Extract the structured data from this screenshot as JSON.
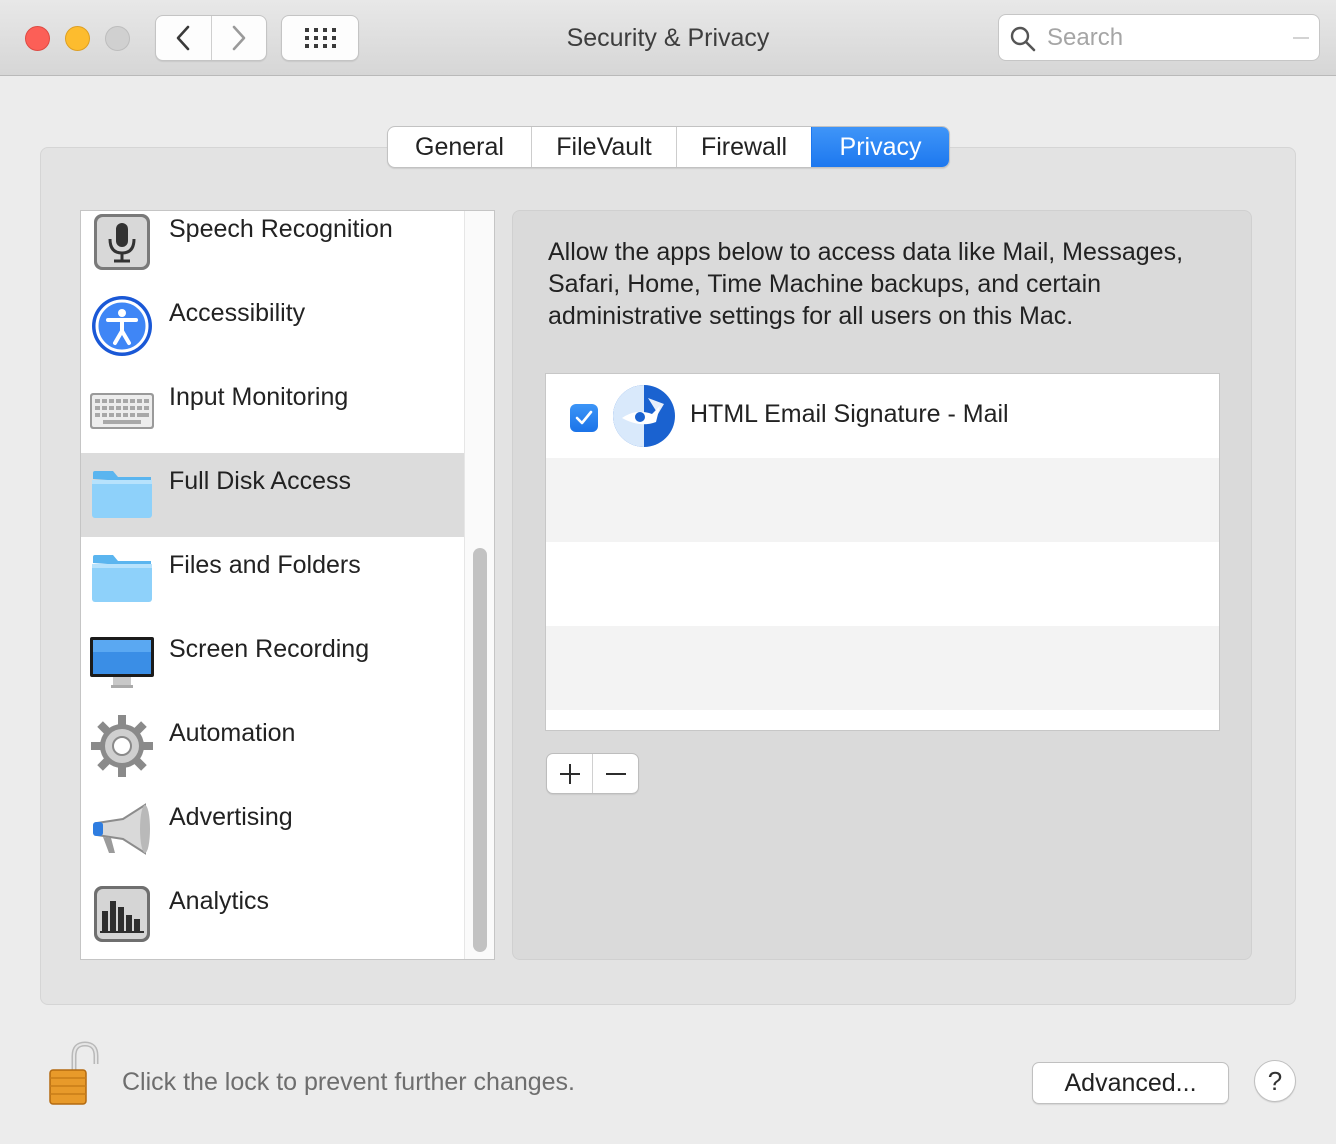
{
  "window": {
    "title": "Security & Privacy"
  },
  "toolbar": {
    "back_icon": "chevron-left-icon",
    "forward_icon": "chevron-right-icon",
    "grid_icon": "show-all-grid-icon",
    "search_placeholder": "Search"
  },
  "tabs": [
    {
      "label": "General",
      "active": false
    },
    {
      "label": "FileVault",
      "active": false
    },
    {
      "label": "Firewall",
      "active": false
    },
    {
      "label": "Privacy",
      "active": true
    }
  ],
  "categories": [
    {
      "label": "Speech Recognition",
      "icon": "microphone-icon",
      "selected": false
    },
    {
      "label": "Accessibility",
      "icon": "accessibility-icon",
      "selected": false
    },
    {
      "label": "Input Monitoring",
      "icon": "keyboard-icon",
      "selected": false
    },
    {
      "label": "Full Disk Access",
      "icon": "folder-icon",
      "selected": true
    },
    {
      "label": "Files and Folders",
      "icon": "folder-icon",
      "selected": false
    },
    {
      "label": "Screen Recording",
      "icon": "display-icon",
      "selected": false
    },
    {
      "label": "Automation",
      "icon": "gear-icon",
      "selected": false
    },
    {
      "label": "Advertising",
      "icon": "megaphone-icon",
      "selected": false
    },
    {
      "label": "Analytics",
      "icon": "bar-chart-icon",
      "selected": false
    }
  ],
  "detail": {
    "description": "Allow the apps below to access data like Mail, Messages, Safari, Home, Time Machine backups, and certain administrative settings for all users on this Mac.",
    "apps": [
      {
        "name": "HTML Email Signature - Mail",
        "checked": true,
        "icon": "html-email-signature-app-icon"
      }
    ],
    "add_label": "+",
    "remove_label": "−"
  },
  "footer": {
    "lock_text": "Click the lock to prevent further changes.",
    "advanced_label": "Advanced...",
    "help_label": "?"
  },
  "colors": {
    "accent": "#1d78ef",
    "window_bg": "#ececec",
    "close": "#fc5f57",
    "minimize": "#fdbc2e"
  }
}
